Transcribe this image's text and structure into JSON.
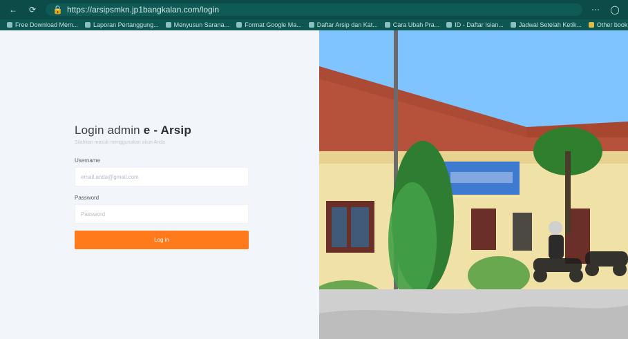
{
  "browser": {
    "url": "https://arsipsmkn.jp1bangkalan.com/login",
    "bookmarks": [
      "Free Download Mem...",
      "Laporan Pertanggung...",
      "Menyusun Sarana...",
      "Format Google Ma...",
      "Daftar Arsip dan Kat...",
      "Cara Ubah Pra...",
      "ID - Daftar Isian...",
      "Jadwal Setelah Ketik...",
      "Other bookmarks"
    ]
  },
  "login": {
    "title_prefix": "Login admin ",
    "title_e": "e",
    "title_suffix": " - Arsip",
    "subtitle": "Silahkan masuk menggunakan akun Anda",
    "username_label": "Username",
    "username_placeholder": "email.anda@gmail.com",
    "password_label": "Password",
    "password_placeholder": "Password",
    "button_label": "Log in"
  }
}
